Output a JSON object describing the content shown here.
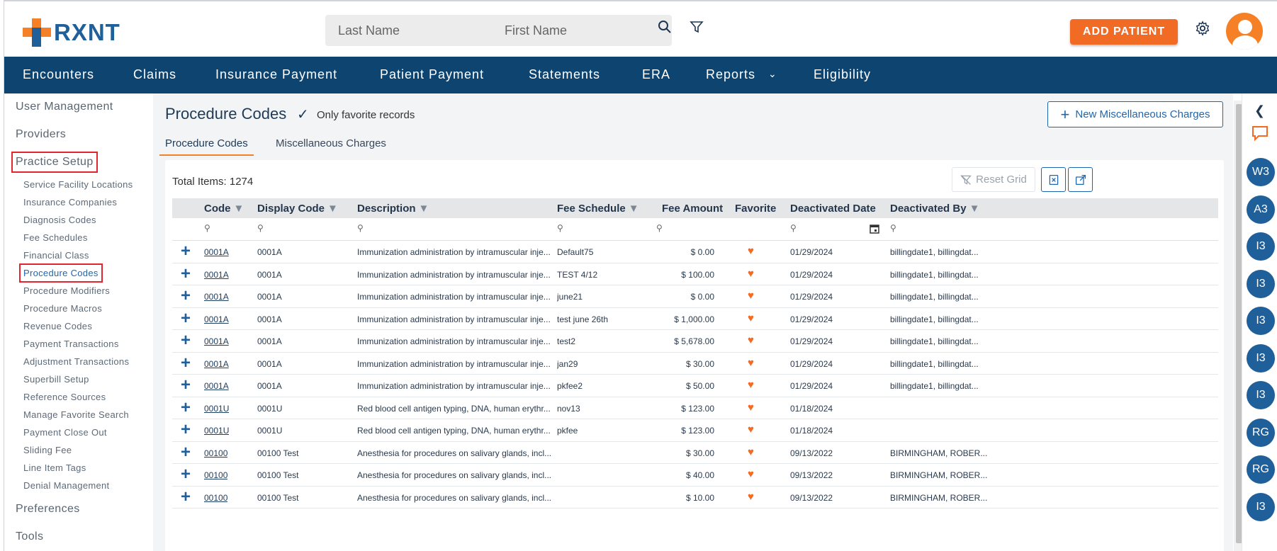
{
  "header": {
    "logo_text": "RXNT",
    "last_name_placeholder": "Last Name",
    "first_name_placeholder": "First Name",
    "add_patient_label": "ADD PATIENT"
  },
  "nav": {
    "items": [
      "Encounters",
      "Claims",
      "Insurance Payment",
      "Patient Payment",
      "Statements",
      "ERA",
      "Reports",
      "Eligibility"
    ]
  },
  "sidebar": {
    "sections": [
      "User Management",
      "Providers",
      "Practice Setup",
      "Preferences",
      "Tools"
    ],
    "practice_setup_items": [
      "Service Facility Locations",
      "Insurance Companies",
      "Diagnosis Codes",
      "Fee Schedules",
      "Financial Class",
      "Procedure Codes",
      "Procedure Modifiers",
      "Procedure Macros",
      "Revenue Codes",
      "Payment Transactions",
      "Adjustment Transactions",
      "Superbill Setup",
      "Reference Sources",
      "Manage Favorite Search",
      "Payment Close Out",
      "Sliding Fee",
      "Line Item Tags",
      "Denial Management"
    ],
    "active_item": "Procedure Codes"
  },
  "main": {
    "title": "Procedure Codes",
    "favorite_toggle_label": "Only favorite records",
    "new_misc_label": "New Miscellaneous Charges",
    "tabs": [
      "Procedure Codes",
      "Miscellaneous Charges"
    ],
    "total_items": "Total Items: 1274",
    "reset_grid_label": "Reset Grid"
  },
  "grid": {
    "columns": [
      "Code",
      "Display Code",
      "Description",
      "Fee Schedule",
      "Fee Amount",
      "Favorite",
      "Deactivated Date",
      "Deactivated By"
    ],
    "rows": [
      {
        "code": "0001A",
        "display_code": "0001A",
        "description": "Immunization administration by intramuscular inje...",
        "fee_schedule": "Default75",
        "fee_amount": "$ 0.00",
        "deactivated_date": "01/29/2024",
        "deactivated_by": "billingdate1, billingdat..."
      },
      {
        "code": "0001A",
        "display_code": "0001A",
        "description": "Immunization administration by intramuscular inje...",
        "fee_schedule": "TEST 4/12",
        "fee_amount": "$ 100.00",
        "deactivated_date": "01/29/2024",
        "deactivated_by": "billingdate1, billingdat..."
      },
      {
        "code": "0001A",
        "display_code": "0001A",
        "description": "Immunization administration by intramuscular inje...",
        "fee_schedule": "june21",
        "fee_amount": "$ 0.00",
        "deactivated_date": "01/29/2024",
        "deactivated_by": "billingdate1, billingdat..."
      },
      {
        "code": "0001A",
        "display_code": "0001A",
        "description": "Immunization administration by intramuscular inje...",
        "fee_schedule": "test june 26th",
        "fee_amount": "$ 1,000.00",
        "deactivated_date": "01/29/2024",
        "deactivated_by": "billingdate1, billingdat..."
      },
      {
        "code": "0001A",
        "display_code": "0001A",
        "description": "Immunization administration by intramuscular inje...",
        "fee_schedule": "test2",
        "fee_amount": "$ 5,678.00",
        "deactivated_date": "01/29/2024",
        "deactivated_by": "billingdate1, billingdat..."
      },
      {
        "code": "0001A",
        "display_code": "0001A",
        "description": "Immunization administration by intramuscular inje...",
        "fee_schedule": "jan29",
        "fee_amount": "$ 30.00",
        "deactivated_date": "01/29/2024",
        "deactivated_by": "billingdate1, billingdat..."
      },
      {
        "code": "0001A",
        "display_code": "0001A",
        "description": "Immunization administration by intramuscular inje...",
        "fee_schedule": "pkfee2",
        "fee_amount": "$ 50.00",
        "deactivated_date": "01/29/2024",
        "deactivated_by": "billingdate1, billingdat..."
      },
      {
        "code": "0001U",
        "display_code": "0001U",
        "description": "Red blood cell antigen typing, DNA, human erythr...",
        "fee_schedule": "nov13",
        "fee_amount": "$ 123.00",
        "deactivated_date": "01/18/2024",
        "deactivated_by": ""
      },
      {
        "code": "0001U",
        "display_code": "0001U",
        "description": "Red blood cell antigen typing, DNA, human erythr...",
        "fee_schedule": "pkfee",
        "fee_amount": "$ 123.00",
        "deactivated_date": "01/18/2024",
        "deactivated_by": ""
      },
      {
        "code": "00100",
        "display_code": "00100 Test",
        "description": "Anesthesia for procedures on salivary glands, incl...",
        "fee_schedule": "",
        "fee_amount": "$ 30.00",
        "deactivated_date": "09/13/2022",
        "deactivated_by": "BIRMINGHAM, ROBER..."
      },
      {
        "code": "00100",
        "display_code": "00100 Test",
        "description": "Anesthesia for procedures on salivary glands, incl...",
        "fee_schedule": "",
        "fee_amount": "$ 40.00",
        "deactivated_date": "09/13/2022",
        "deactivated_by": "BIRMINGHAM, ROBER..."
      },
      {
        "code": "00100",
        "display_code": "00100 Test",
        "description": "Anesthesia for procedures on salivary glands, incl...",
        "fee_schedule": "",
        "fee_amount": "$ 10.00",
        "deactivated_date": "09/13/2022",
        "deactivated_by": "BIRMINGHAM, ROBER..."
      }
    ]
  },
  "rail": {
    "badges": [
      "W3",
      "A3",
      "I3",
      "I3",
      "I3",
      "I3",
      "I3",
      "RG",
      "RG",
      "I3"
    ]
  },
  "colors": {
    "brand_blue": "#0d4470",
    "accent_orange": "#f26b25",
    "link_blue": "#1f66b0",
    "highlight_red": "#e0262f"
  }
}
